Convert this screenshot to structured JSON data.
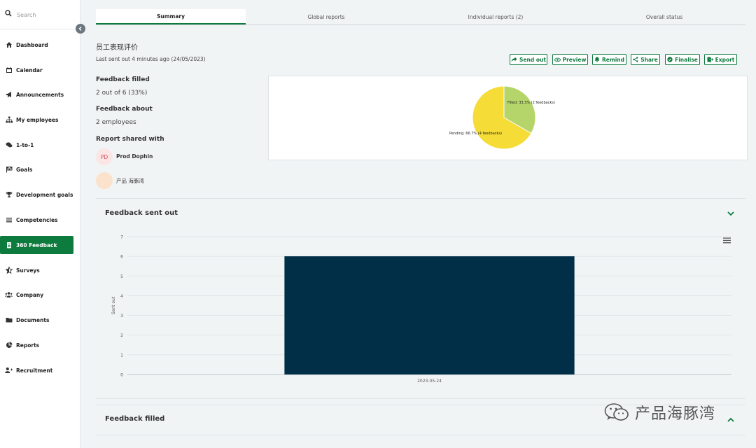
{
  "search": {
    "placeholder": "Search"
  },
  "sidebar": {
    "items": [
      {
        "label": "Dashboard"
      },
      {
        "label": "Calendar"
      },
      {
        "label": "Announcements"
      },
      {
        "label": "My employees"
      },
      {
        "label": "1-to-1"
      },
      {
        "label": "Goals"
      },
      {
        "label": "Development goals"
      },
      {
        "label": "Competencies"
      },
      {
        "label": "360 Feedback"
      },
      {
        "label": "Surveys"
      },
      {
        "label": "Company"
      },
      {
        "label": "Documents"
      },
      {
        "label": "Reports"
      },
      {
        "label": "Recruitment"
      }
    ]
  },
  "tabs": [
    {
      "label": "Summary"
    },
    {
      "label": "Global reports"
    },
    {
      "label": "Individual reports (2)"
    },
    {
      "label": "Overall status"
    }
  ],
  "header": {
    "title": "员工表现评价",
    "last_sent": "Last sent out 4 minutes ago (24/05/2023)"
  },
  "actions": [
    {
      "label": "Send out"
    },
    {
      "label": "Preview"
    },
    {
      "label": "Remind"
    },
    {
      "label": "Share"
    },
    {
      "label": "Finalise"
    },
    {
      "label": "Export"
    }
  ],
  "stats": {
    "filled_label": "Feedback filled",
    "filled_value": "2 out of 6 (33%)",
    "about_label": "Feedback about",
    "about_value": "2 employees",
    "shared_label": "Report shared with"
  },
  "shared_with": [
    {
      "initials": "PD",
      "name": "Prod Dophin"
    },
    {
      "initials": "",
      "name": "产品 海豚湾"
    }
  ],
  "pie_chart_data": {
    "type": "pie",
    "slices": [
      {
        "label": "Filled: 33.3% (2 feedbacks)",
        "value": 2,
        "color": "#b5d56a"
      },
      {
        "label": "Pending: 66.7% (4 feedbacks)",
        "value": 4,
        "color": "#f5dc37"
      }
    ]
  },
  "sections": {
    "sent_out_title": "Feedback sent out",
    "filled_title": "Feedback filled"
  },
  "chart_data": {
    "type": "bar",
    "categories": [
      "2023-05-24"
    ],
    "values": [
      6
    ],
    "title": "",
    "xlabel": "",
    "ylabel": "Sent out",
    "ylim": [
      0,
      7
    ],
    "yticks": [
      "0",
      "1",
      "2",
      "3",
      "4",
      "5",
      "6",
      "7"
    ],
    "color": "#002f47",
    "grid": true
  },
  "watermark": {
    "text": "产品海豚湾"
  },
  "colors": {
    "accent": "#0d7a3e",
    "bar": "#002f47"
  }
}
